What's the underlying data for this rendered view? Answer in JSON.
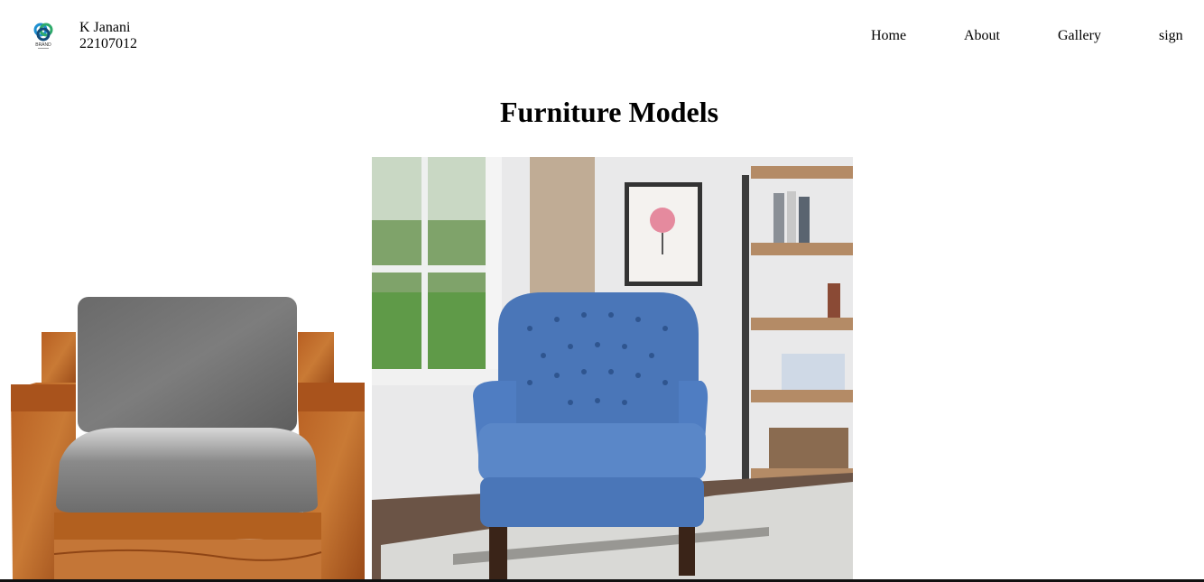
{
  "header": {
    "logo_text": "BRAND",
    "user_name": "K Janani",
    "user_id": "22107012"
  },
  "nav": {
    "home": "Home",
    "about": "About",
    "gallery": "Gallery",
    "sign": "sign"
  },
  "main": {
    "title": "Furniture Models"
  },
  "gallery": {
    "images": [
      {
        "name": "wooden-armchair-grey-cushions"
      },
      {
        "name": "blue-tufted-armchair-room"
      }
    ]
  }
}
